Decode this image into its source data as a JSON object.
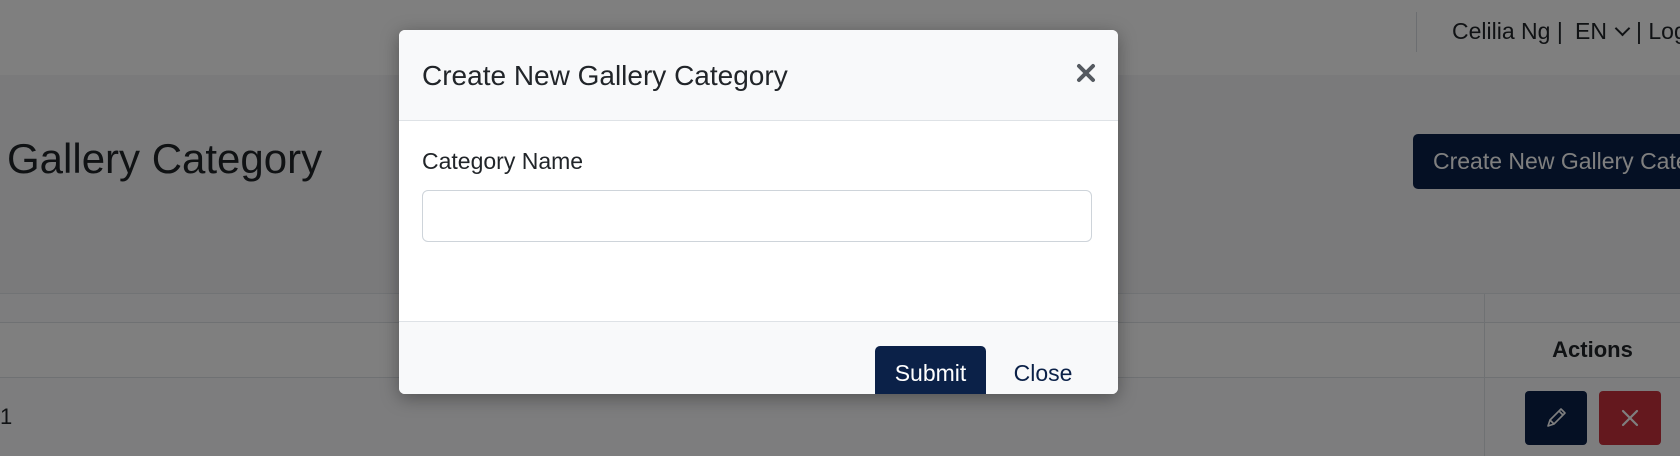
{
  "topbar": {
    "user_label": "Celilia Ng |",
    "language": "EN",
    "logout_label": "| Log"
  },
  "page": {
    "title": "Gallery Category",
    "create_button": "Create New Gallery Cate"
  },
  "table": {
    "actions_header": "Actions",
    "rows": [
      {
        "number": "1"
      }
    ]
  },
  "modal": {
    "title": "Create New Gallery Category",
    "field_label": "Category Name",
    "field_value": "",
    "submit_label": "Submit",
    "close_label": "Close"
  },
  "colors": {
    "primary": "#0b2148",
    "danger": "#c9303c",
    "overlay": "rgba(0,0,0,0.5)"
  },
  "icons": [
    "chevron-down-icon",
    "pencil-icon",
    "x-icon",
    "close-icon"
  ]
}
